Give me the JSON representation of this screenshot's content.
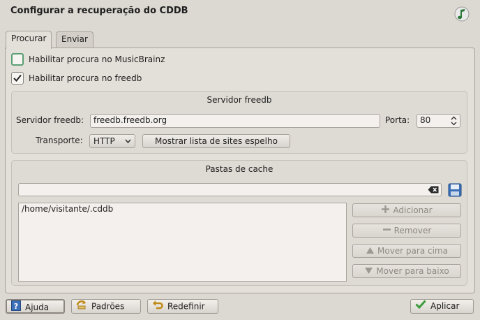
{
  "window": {
    "title": "Configurar a recuperação do CDDB",
    "icon": "music-note-icon"
  },
  "tabs": [
    {
      "label": "Procurar",
      "active": true
    },
    {
      "label": "Enviar",
      "active": false
    }
  ],
  "options": {
    "musicbrainz": {
      "label": "Habilitar procura no MusicBrainz",
      "checked": false
    },
    "freedb": {
      "label": "Habilitar procura no freedb",
      "checked": true
    }
  },
  "freedb_server": {
    "title": "Servidor freedb",
    "server_label": "Servidor freedb:",
    "server_value": "freedb.freedb.org",
    "port_label": "Porta:",
    "port_value": "80",
    "transport_label": "Transporte:",
    "transport_value": "HTTP",
    "mirror_button": "Mostrar lista de sites espelho"
  },
  "cache": {
    "title": "Pastas de cache",
    "path_input_value": "",
    "folders": [
      "/home/visitante/.cddb"
    ],
    "add_label": "Adicionar",
    "remove_label": "Remover",
    "move_up_label": "Mover para cima",
    "move_down_label": "Mover para baixo"
  },
  "footer": {
    "help_label": "Ajuda",
    "defaults_label": "Padrões",
    "reset_label": "Redefinir",
    "apply_label": "Aplicar"
  },
  "colors": {
    "background": "#dcd8d2",
    "focus_green": "#5a9f74",
    "check_green": "#3c9c3c"
  }
}
